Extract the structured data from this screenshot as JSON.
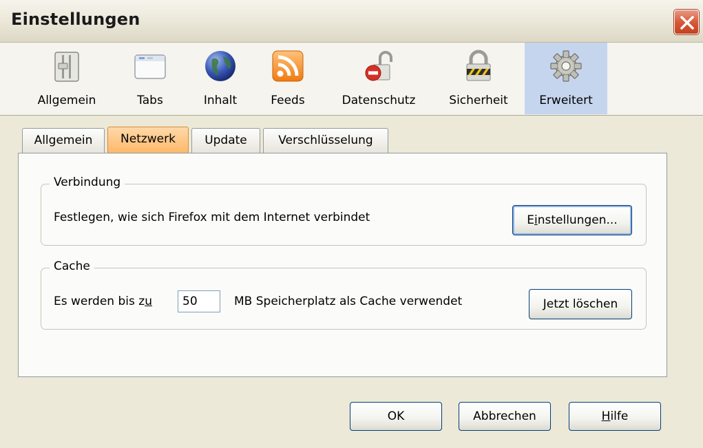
{
  "window": {
    "title": "Einstellungen",
    "close_icon": "close-icon"
  },
  "toolbar": {
    "items": [
      {
        "label": "Allgemein",
        "icon": "general-switch-icon"
      },
      {
        "label": "Tabs",
        "icon": "tabs-window-icon"
      },
      {
        "label": "Inhalt",
        "icon": "globe-icon"
      },
      {
        "label": "Feeds",
        "icon": "rss-feed-icon"
      },
      {
        "label": "Datenschutz",
        "icon": "privacy-lock-icon"
      },
      {
        "label": "Sicherheit",
        "icon": "padlock-icon"
      },
      {
        "label": "Erweitert",
        "icon": "gear-icon"
      }
    ],
    "selected": "Erweitert"
  },
  "subtabs": {
    "items": [
      "Allgemein",
      "Netzwerk",
      "Update",
      "Verschlüsselung"
    ],
    "active": "Netzwerk"
  },
  "connection": {
    "title": "Verbindung",
    "description": "Festlegen, wie sich Firefox mit dem Internet verbindet",
    "button_pre": "E",
    "button_accel": "i",
    "button_post": "nstellungen..."
  },
  "cache": {
    "title": "Cache",
    "text_before_pre": "Es werden bis z",
    "text_before_accel": "u",
    "value": "50",
    "text_after": "MB Speicherplatz als Cache verwendet",
    "button_label": "Jetzt löschen"
  },
  "footer": {
    "ok_label": "OK",
    "cancel_label": "Abbrechen",
    "help_accel": "H",
    "help_post": "ilfe"
  },
  "colors": {
    "selected_toolbar_bg": "#c5d5ee",
    "active_tab_bg": "#ffb86b",
    "close_button_red": "#d8593a"
  }
}
